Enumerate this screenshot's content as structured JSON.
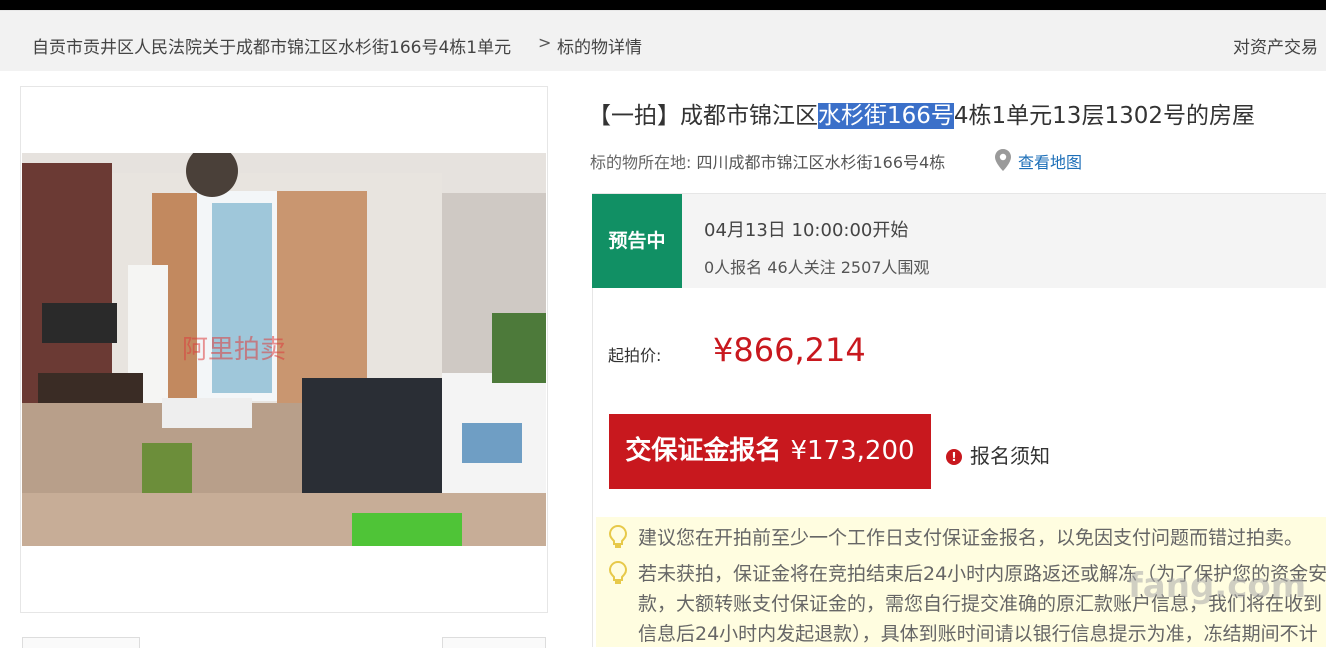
{
  "breadcrumb": {
    "item_1": "自贡市贡井区人民法院关于成都市锦江区水杉街166号4栋1单元",
    "separator": ">",
    "item_2": "标的物详情"
  },
  "header_right_link": "对资产交易",
  "listing": {
    "title_prefix": "【一拍】成都市锦江区",
    "title_highlight": "水杉街166号",
    "title_suffix": "4栋1单元13层1302号的房屋",
    "location_label": "标的物所在地:",
    "location_value": "四川成都市锦江区水杉街166号4栋",
    "map_link": "查看地图"
  },
  "status": {
    "badge": "预告中",
    "start_time": "04月13日 10:00:00开始",
    "stats": "0人报名  46人关注  2507人围观"
  },
  "price": {
    "label": "起拍价:",
    "value": "¥866,214"
  },
  "actions": {
    "deposit_label": "交保证金报名",
    "deposit_amount": "¥173,200",
    "notice_label": "报名须知",
    "notice_icon": "!"
  },
  "tips": [
    "建议您在开拍前至少一个工作日支付保证金报名，以免因支付问题而错过拍卖。",
    "若未获拍，保证金将在竞拍结束后24小时内原路返还或解冻（为了保护您的资金安",
    "款，大额转账支付保证金的，需您自行提交准确的原汇款账户信息，我们将在收到",
    "信息后24小时内发起退款），具体到账时间请以银行信息提示为准，冻结期间不计"
  ],
  "photo_watermark": "阿里拍卖",
  "watermark": "fang.com",
  "colors": {
    "status_green": "#119064",
    "price_red": "#c8181e",
    "link_blue": "#1d6fb8",
    "highlight_blue": "#3b70c9",
    "tip_background": "#fffde0"
  },
  "icons": [
    "location-pin-icon",
    "alert-icon",
    "lightbulb-icon"
  ]
}
